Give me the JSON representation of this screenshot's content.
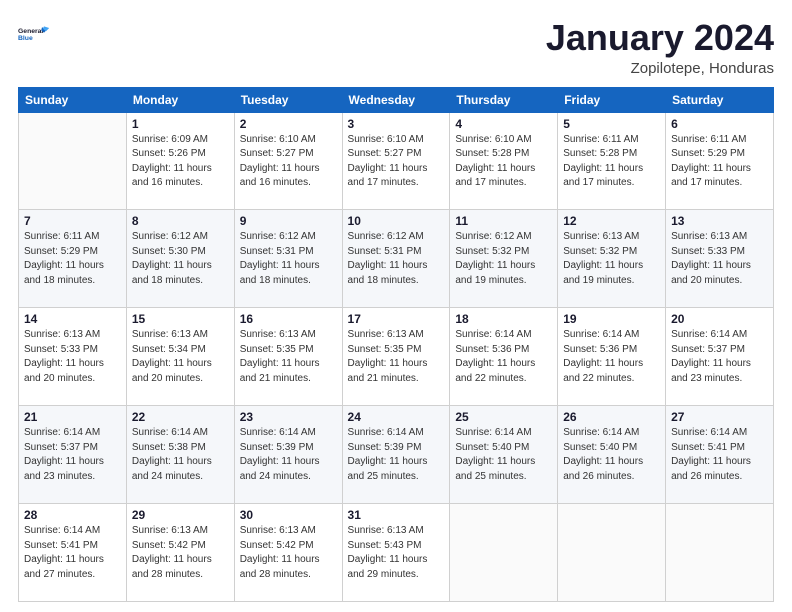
{
  "logo": {
    "line1": "General",
    "line2": "Blue"
  },
  "title": "January 2024",
  "location": "Zopilotepe, Honduras",
  "weekdays": [
    "Sunday",
    "Monday",
    "Tuesday",
    "Wednesday",
    "Thursday",
    "Friday",
    "Saturday"
  ],
  "weeks": [
    [
      {
        "day": "",
        "info": ""
      },
      {
        "day": "1",
        "info": "Sunrise: 6:09 AM\nSunset: 5:26 PM\nDaylight: 11 hours\nand 16 minutes."
      },
      {
        "day": "2",
        "info": "Sunrise: 6:10 AM\nSunset: 5:27 PM\nDaylight: 11 hours\nand 16 minutes."
      },
      {
        "day": "3",
        "info": "Sunrise: 6:10 AM\nSunset: 5:27 PM\nDaylight: 11 hours\nand 17 minutes."
      },
      {
        "day": "4",
        "info": "Sunrise: 6:10 AM\nSunset: 5:28 PM\nDaylight: 11 hours\nand 17 minutes."
      },
      {
        "day": "5",
        "info": "Sunrise: 6:11 AM\nSunset: 5:28 PM\nDaylight: 11 hours\nand 17 minutes."
      },
      {
        "day": "6",
        "info": "Sunrise: 6:11 AM\nSunset: 5:29 PM\nDaylight: 11 hours\nand 17 minutes."
      }
    ],
    [
      {
        "day": "7",
        "info": "Sunrise: 6:11 AM\nSunset: 5:29 PM\nDaylight: 11 hours\nand 18 minutes."
      },
      {
        "day": "8",
        "info": "Sunrise: 6:12 AM\nSunset: 5:30 PM\nDaylight: 11 hours\nand 18 minutes."
      },
      {
        "day": "9",
        "info": "Sunrise: 6:12 AM\nSunset: 5:31 PM\nDaylight: 11 hours\nand 18 minutes."
      },
      {
        "day": "10",
        "info": "Sunrise: 6:12 AM\nSunset: 5:31 PM\nDaylight: 11 hours\nand 18 minutes."
      },
      {
        "day": "11",
        "info": "Sunrise: 6:12 AM\nSunset: 5:32 PM\nDaylight: 11 hours\nand 19 minutes."
      },
      {
        "day": "12",
        "info": "Sunrise: 6:13 AM\nSunset: 5:32 PM\nDaylight: 11 hours\nand 19 minutes."
      },
      {
        "day": "13",
        "info": "Sunrise: 6:13 AM\nSunset: 5:33 PM\nDaylight: 11 hours\nand 20 minutes."
      }
    ],
    [
      {
        "day": "14",
        "info": "Sunrise: 6:13 AM\nSunset: 5:33 PM\nDaylight: 11 hours\nand 20 minutes."
      },
      {
        "day": "15",
        "info": "Sunrise: 6:13 AM\nSunset: 5:34 PM\nDaylight: 11 hours\nand 20 minutes."
      },
      {
        "day": "16",
        "info": "Sunrise: 6:13 AM\nSunset: 5:35 PM\nDaylight: 11 hours\nand 21 minutes."
      },
      {
        "day": "17",
        "info": "Sunrise: 6:13 AM\nSunset: 5:35 PM\nDaylight: 11 hours\nand 21 minutes."
      },
      {
        "day": "18",
        "info": "Sunrise: 6:14 AM\nSunset: 5:36 PM\nDaylight: 11 hours\nand 22 minutes."
      },
      {
        "day": "19",
        "info": "Sunrise: 6:14 AM\nSunset: 5:36 PM\nDaylight: 11 hours\nand 22 minutes."
      },
      {
        "day": "20",
        "info": "Sunrise: 6:14 AM\nSunset: 5:37 PM\nDaylight: 11 hours\nand 23 minutes."
      }
    ],
    [
      {
        "day": "21",
        "info": "Sunrise: 6:14 AM\nSunset: 5:37 PM\nDaylight: 11 hours\nand 23 minutes."
      },
      {
        "day": "22",
        "info": "Sunrise: 6:14 AM\nSunset: 5:38 PM\nDaylight: 11 hours\nand 24 minutes."
      },
      {
        "day": "23",
        "info": "Sunrise: 6:14 AM\nSunset: 5:39 PM\nDaylight: 11 hours\nand 24 minutes."
      },
      {
        "day": "24",
        "info": "Sunrise: 6:14 AM\nSunset: 5:39 PM\nDaylight: 11 hours\nand 25 minutes."
      },
      {
        "day": "25",
        "info": "Sunrise: 6:14 AM\nSunset: 5:40 PM\nDaylight: 11 hours\nand 25 minutes."
      },
      {
        "day": "26",
        "info": "Sunrise: 6:14 AM\nSunset: 5:40 PM\nDaylight: 11 hours\nand 26 minutes."
      },
      {
        "day": "27",
        "info": "Sunrise: 6:14 AM\nSunset: 5:41 PM\nDaylight: 11 hours\nand 26 minutes."
      }
    ],
    [
      {
        "day": "28",
        "info": "Sunrise: 6:14 AM\nSunset: 5:41 PM\nDaylight: 11 hours\nand 27 minutes."
      },
      {
        "day": "29",
        "info": "Sunrise: 6:13 AM\nSunset: 5:42 PM\nDaylight: 11 hours\nand 28 minutes."
      },
      {
        "day": "30",
        "info": "Sunrise: 6:13 AM\nSunset: 5:42 PM\nDaylight: 11 hours\nand 28 minutes."
      },
      {
        "day": "31",
        "info": "Sunrise: 6:13 AM\nSunset: 5:43 PM\nDaylight: 11 hours\nand 29 minutes."
      },
      {
        "day": "",
        "info": ""
      },
      {
        "day": "",
        "info": ""
      },
      {
        "day": "",
        "info": ""
      }
    ]
  ]
}
